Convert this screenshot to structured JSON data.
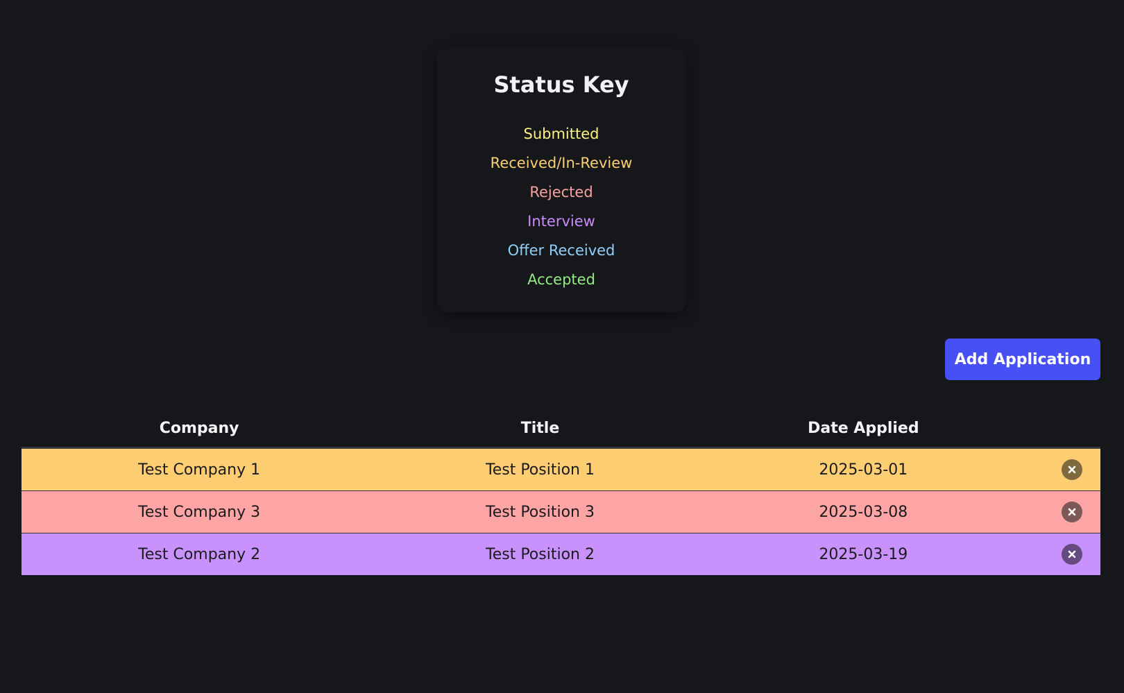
{
  "status_key": {
    "title": "Status Key",
    "items": [
      {
        "label": "Submitted",
        "color": "#fdf07e"
      },
      {
        "label": "Received/In-Review",
        "color": "#f9cf72"
      },
      {
        "label": "Rejected",
        "color": "#f7a1a1"
      },
      {
        "label": "Interview",
        "color": "#c98bf8"
      },
      {
        "label": "Offer Received",
        "color": "#8fd0fb"
      },
      {
        "label": "Accepted",
        "color": "#95ea86"
      }
    ]
  },
  "toolbar": {
    "add_label": "Add Application"
  },
  "table": {
    "headers": {
      "company": "Company",
      "title": "Title",
      "date": "Date Applied"
    },
    "rows": [
      {
        "company": "Test Company 1",
        "title": "Test Position 1",
        "date": "2025-03-01",
        "status": "Received/In-Review",
        "row_color": "#fdcd72",
        "delete_color": "#7e6a3c",
        "delete_icon": "close-circle-icon"
      },
      {
        "company": "Test Company 3",
        "title": "Test Position 3",
        "date": "2025-03-08",
        "status": "Rejected",
        "row_color": "#fda4a4",
        "delete_color": "#7c5858",
        "delete_icon": "close-circle-icon"
      },
      {
        "company": "Test Company 2",
        "title": "Test Position 2",
        "date": "2025-03-19",
        "status": "Interview",
        "row_color": "#c891fc",
        "delete_color": "#654b80",
        "delete_icon": "close-circle-icon"
      }
    ]
  }
}
